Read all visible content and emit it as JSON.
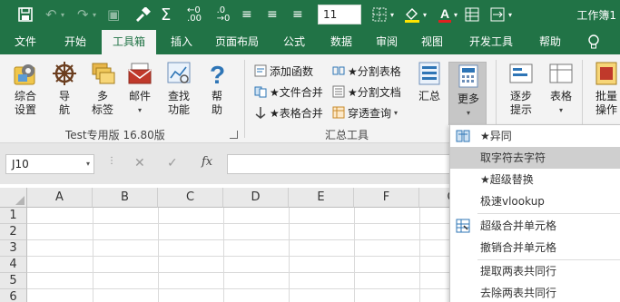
{
  "quick_access": {
    "font_size": "11",
    "window_title": "工作簿1"
  },
  "tabs": [
    {
      "label": "文件"
    },
    {
      "label": "开始"
    },
    {
      "label": "工具箱"
    },
    {
      "label": "插入"
    },
    {
      "label": "页面布局"
    },
    {
      "label": "公式"
    },
    {
      "label": "数据"
    },
    {
      "label": "审阅"
    },
    {
      "label": "视图"
    },
    {
      "label": "开发工具"
    },
    {
      "label": "帮助"
    }
  ],
  "ribbon": {
    "group1": {
      "label": "Test专用版 16.80版",
      "buttons": [
        {
          "line1": "综合",
          "line2": "设置",
          "icon": "settings-icon"
        },
        {
          "line1": "导",
          "line2": "航",
          "icon": "ship-wheel-icon"
        },
        {
          "line1": "多",
          "line2": "标签",
          "icon": "folders-icon"
        },
        {
          "line1": "邮件",
          "line2": "",
          "icon": "mail-icon"
        },
        {
          "line1": "查找",
          "line2": "功能",
          "icon": "find-chart-icon"
        },
        {
          "line1": "帮",
          "line2": "助",
          "icon": "question-icon"
        }
      ]
    },
    "group2": {
      "label": "汇总工具",
      "small_buttons": [
        {
          "label": "添加函数",
          "icon": "add-function-icon"
        },
        {
          "label": "★文件合并",
          "icon": "file-merge-icon"
        },
        {
          "label": "★表格合并",
          "icon": "table-merge-icon"
        },
        {
          "label": "★分割表格",
          "icon": "split-table-icon"
        },
        {
          "label": "★分割文档",
          "icon": "split-doc-icon"
        },
        {
          "label": "穿透查询",
          "icon": "drill-query-icon"
        }
      ],
      "summary_label": "汇总",
      "more_label": "更多"
    },
    "group3": {
      "step_line1": "逐步",
      "step_line2": "提示",
      "table_label": "表格",
      "batch_line1": "批量",
      "batch_line2": "操作"
    }
  },
  "formula_bar": {
    "name_box": "J10",
    "fx": "fx",
    "formula": ""
  },
  "grid": {
    "columns": [
      "A",
      "B",
      "C",
      "D",
      "E",
      "F",
      "G"
    ],
    "rows": [
      "1",
      "2",
      "3",
      "4",
      "5",
      "6"
    ]
  },
  "more_menu": {
    "items": [
      {
        "label": "★异同",
        "icon": "compare-icon"
      },
      {
        "label": "取字符去字符",
        "icon": ""
      },
      {
        "label": "★超级替换",
        "icon": ""
      },
      {
        "label": "极速vlookup",
        "icon": ""
      },
      {
        "label": "超级合并单元格",
        "icon": "merge-cells-icon"
      },
      {
        "label": "撤销合并单元格",
        "icon": ""
      },
      {
        "label": "提取两表共同行",
        "icon": ""
      },
      {
        "label": "去除两表共同行",
        "icon": ""
      }
    ]
  },
  "colors": {
    "brand_green": "#217346",
    "font_color_red": "#e02020",
    "highlight_yellow": "#ffe400"
  }
}
